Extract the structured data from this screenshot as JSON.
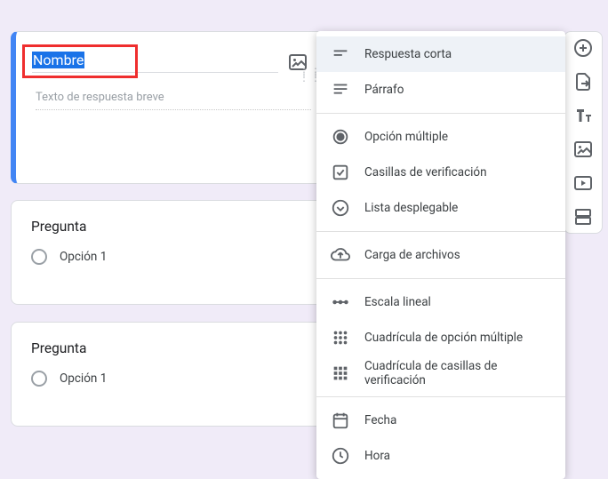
{
  "active_question": {
    "title_text": "Nombre",
    "hint": "Texto de respuesta breve"
  },
  "questions": [
    {
      "title": "Pregunta",
      "option": "Opción 1"
    },
    {
      "title": "Pregunta",
      "option": "Opción 1"
    }
  ],
  "menu": {
    "short_answer": "Respuesta corta",
    "paragraph": "Párrafo",
    "multiple_choice": "Opción múltiple",
    "checkboxes": "Casillas de verificación",
    "dropdown": "Lista desplegable",
    "file_upload": "Carga de archivos",
    "linear_scale": "Escala lineal",
    "mc_grid": "Cuadrícula de opción múltiple",
    "cb_grid": "Cuadrícula de casillas de verificación",
    "date": "Fecha",
    "time": "Hora"
  }
}
